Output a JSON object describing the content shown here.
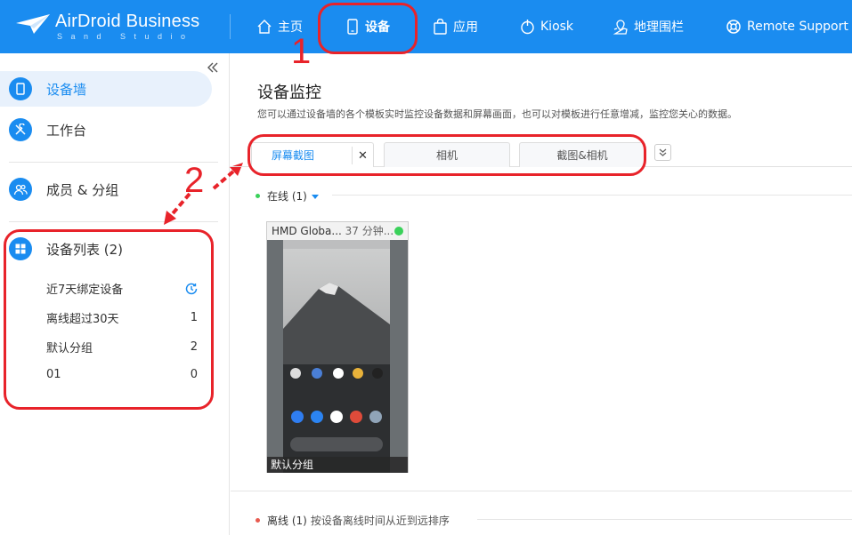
{
  "header": {
    "logo_text": "AirDroid Business",
    "logo_sub": "Sand Studio",
    "nav": [
      {
        "label": "主页",
        "icon": "home-icon"
      },
      {
        "label": "设备",
        "icon": "phone-icon"
      },
      {
        "label": "应用",
        "icon": "bag-icon"
      },
      {
        "label": "Kiosk",
        "icon": "kiosk-icon"
      },
      {
        "label": "地理围栏",
        "icon": "geofence-icon"
      },
      {
        "label": "Remote Support",
        "icon": "lifebuoy-icon"
      }
    ]
  },
  "annotations": {
    "one": "1",
    "two": "2"
  },
  "sidebar": {
    "items": [
      {
        "label": "设备墙",
        "icon": "device-wall-icon"
      },
      {
        "label": "工作台",
        "icon": "workbench-icon"
      },
      {
        "label": "成员 & 分组",
        "icon": "members-icon"
      },
      {
        "label": "设备列表 (2)",
        "icon": "device-list-icon"
      }
    ],
    "sub_items": [
      {
        "label": "近7天绑定设备",
        "count": ""
      },
      {
        "label": "离线超过30天",
        "count": "1"
      },
      {
        "label": "默认分组",
        "count": "2"
      },
      {
        "label": "01",
        "count": "0"
      }
    ]
  },
  "main": {
    "title": "设备监控",
    "desc": "您可以通过设备墙的各个模板实时监控设备数据和屏幕画面，也可以对模板进行任意增减，监控您关心的数据。",
    "tabs": [
      "屏幕截图",
      "相机",
      "截图&相机"
    ],
    "online_section": "在线 (1)",
    "offline_section": "离线 (1)",
    "offline_desc": "按设备离线时间从近到远排序",
    "device": {
      "name": "HMD Globa...",
      "time": "37 分钟...",
      "group": "默认分组"
    }
  },
  "colors": {
    "brand": "#1a8cf0",
    "annotation": "#e8232a",
    "online": "#3ad15a",
    "offline": "#e85a4f"
  }
}
